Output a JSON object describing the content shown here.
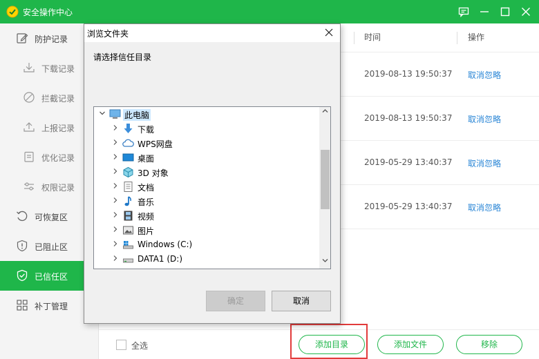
{
  "app": {
    "title": "安全操作中心"
  },
  "sidebar": {
    "items": [
      {
        "label": "防护记录",
        "icon": "edit-icon"
      },
      {
        "label": "下载记录",
        "icon": "download-icon"
      },
      {
        "label": "拦截记录",
        "icon": "block-icon"
      },
      {
        "label": "上报记录",
        "icon": "upload-icon"
      },
      {
        "label": "优化记录",
        "icon": "clipboard-icon"
      },
      {
        "label": "权限记录",
        "icon": "sliders-icon"
      },
      {
        "label": "可恢复区",
        "icon": "restore-icon"
      },
      {
        "label": "已阻止区",
        "icon": "shield-alert-icon"
      },
      {
        "label": "已信任区",
        "icon": "shield-check-icon",
        "active": true
      },
      {
        "label": "补丁管理",
        "icon": "grid-icon"
      }
    ]
  },
  "table": {
    "columns": {
      "time": "时间",
      "action": "操作"
    },
    "rows": [
      {
        "time": "2019-08-13 19:50:37",
        "action": "取消忽略"
      },
      {
        "time": "2019-08-13 19:50:37",
        "action": "取消忽略"
      },
      {
        "time": "2019-05-29 13:40:37",
        "action": "取消忽略"
      },
      {
        "time": "2019-05-29 13:40:37",
        "action": "取消忽略"
      }
    ]
  },
  "footer": {
    "select_all": "全选",
    "add_folder": "添加目录",
    "add_file": "添加文件",
    "remove": "移除"
  },
  "dialog": {
    "title": "浏览文件夹",
    "prompt": "请选择信任目录",
    "ok": "确定",
    "cancel": "取消",
    "tree": [
      {
        "label": "此电脑",
        "icon": "computer-icon",
        "expanded": true,
        "selected": true
      },
      {
        "label": "下载",
        "icon": "download-folder-icon"
      },
      {
        "label": "WPS网盘",
        "icon": "cloud-icon"
      },
      {
        "label": "桌面",
        "icon": "desktop-icon"
      },
      {
        "label": "3D 对象",
        "icon": "3d-objects-icon"
      },
      {
        "label": "文档",
        "icon": "document-icon"
      },
      {
        "label": "音乐",
        "icon": "music-icon"
      },
      {
        "label": "视频",
        "icon": "video-icon"
      },
      {
        "label": "图片",
        "icon": "picture-icon"
      },
      {
        "label": "Windows (C:)",
        "icon": "windows-drive-icon"
      },
      {
        "label": "DATA1 (D:)",
        "icon": "drive-icon"
      }
    ]
  },
  "colors": {
    "brand_green": "#1fb64a",
    "link_blue": "#2a86d6",
    "highlight_red": "#e23b3b"
  }
}
